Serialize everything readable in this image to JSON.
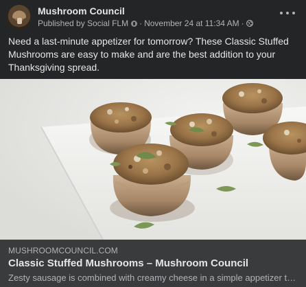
{
  "post": {
    "page_name": "Mushroom Council",
    "published_by": "Published by Social FLM",
    "separator": "·",
    "timestamp": "November 24 at 11:34 AM",
    "audience_icon": "globe-icon",
    "more_icon": "more-options-icon",
    "caption": "Need a last-minute appetizer for tomorrow? These Classic Stuffed Mushrooms are easy to make and are the best addition to your Thanksgiving spread."
  },
  "link": {
    "domain": "MUSHROOMCOUNCIL.COM",
    "title": "Classic Stuffed Mushrooms – Mushroom Council",
    "description": "Zesty sausage is combined with creamy cheese in a simple appetizer that is sure to please."
  },
  "colors": {
    "background": "#242526",
    "link_box": "#3a3b3c",
    "primary_text": "#e4e6eb",
    "secondary_text": "#b0b3b8"
  }
}
